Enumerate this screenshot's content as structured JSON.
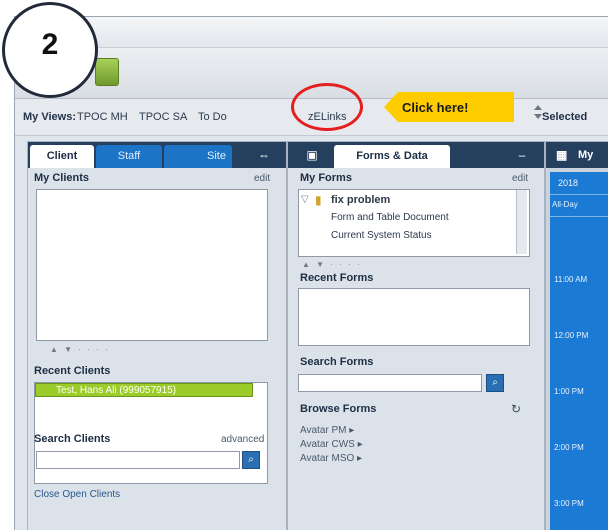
{
  "callout": {
    "step_number": "2",
    "click_label": "Click here!"
  },
  "views_bar": {
    "label": "My Views:",
    "views": [
      "TPOC MH",
      "TPOC SA",
      "To Do",
      "zELinks"
    ],
    "selected_label": "Selected"
  },
  "client_panel": {
    "tabs": [
      "Client",
      "Staff",
      "Site"
    ],
    "my_clients": {
      "title": "My Clients",
      "edit_link": "edit"
    },
    "recent_clients": {
      "title": "Recent Clients",
      "items": [
        "Test, Hans Ali (999057915)"
      ]
    },
    "search_clients": {
      "title": "Search Clients",
      "advanced_link": "advanced"
    },
    "close_open_clients": "Close Open Clients"
  },
  "forms_panel": {
    "tab": "Forms & Data",
    "my_forms": {
      "title": "My Forms",
      "edit_link": "edit",
      "folder": "fix problem",
      "items": [
        "Form and Table Document",
        "Current System Status"
      ]
    },
    "recent_forms": {
      "title": "Recent Forms"
    },
    "search_forms": {
      "title": "Search Forms"
    },
    "browse_forms": {
      "title": "Browse Forms",
      "items": [
        "Avatar PM ▸",
        "Avatar CWS ▸",
        "Avatar MSO ▸"
      ]
    }
  },
  "calendar_panel": {
    "tab": "My",
    "year": "2018",
    "all_day": "All-Day",
    "times": [
      "11:00 AM",
      "12:00 PM",
      "1:00 PM",
      "2:00 PM",
      "3:00 PM"
    ]
  },
  "colors": {
    "accent_blue": "#1d74c7",
    "calendar_blue": "#1a7ad4",
    "selected_green": "#9ccc2a",
    "highlight_red": "#e41f1f",
    "callout_yellow": "#ffcc00"
  }
}
